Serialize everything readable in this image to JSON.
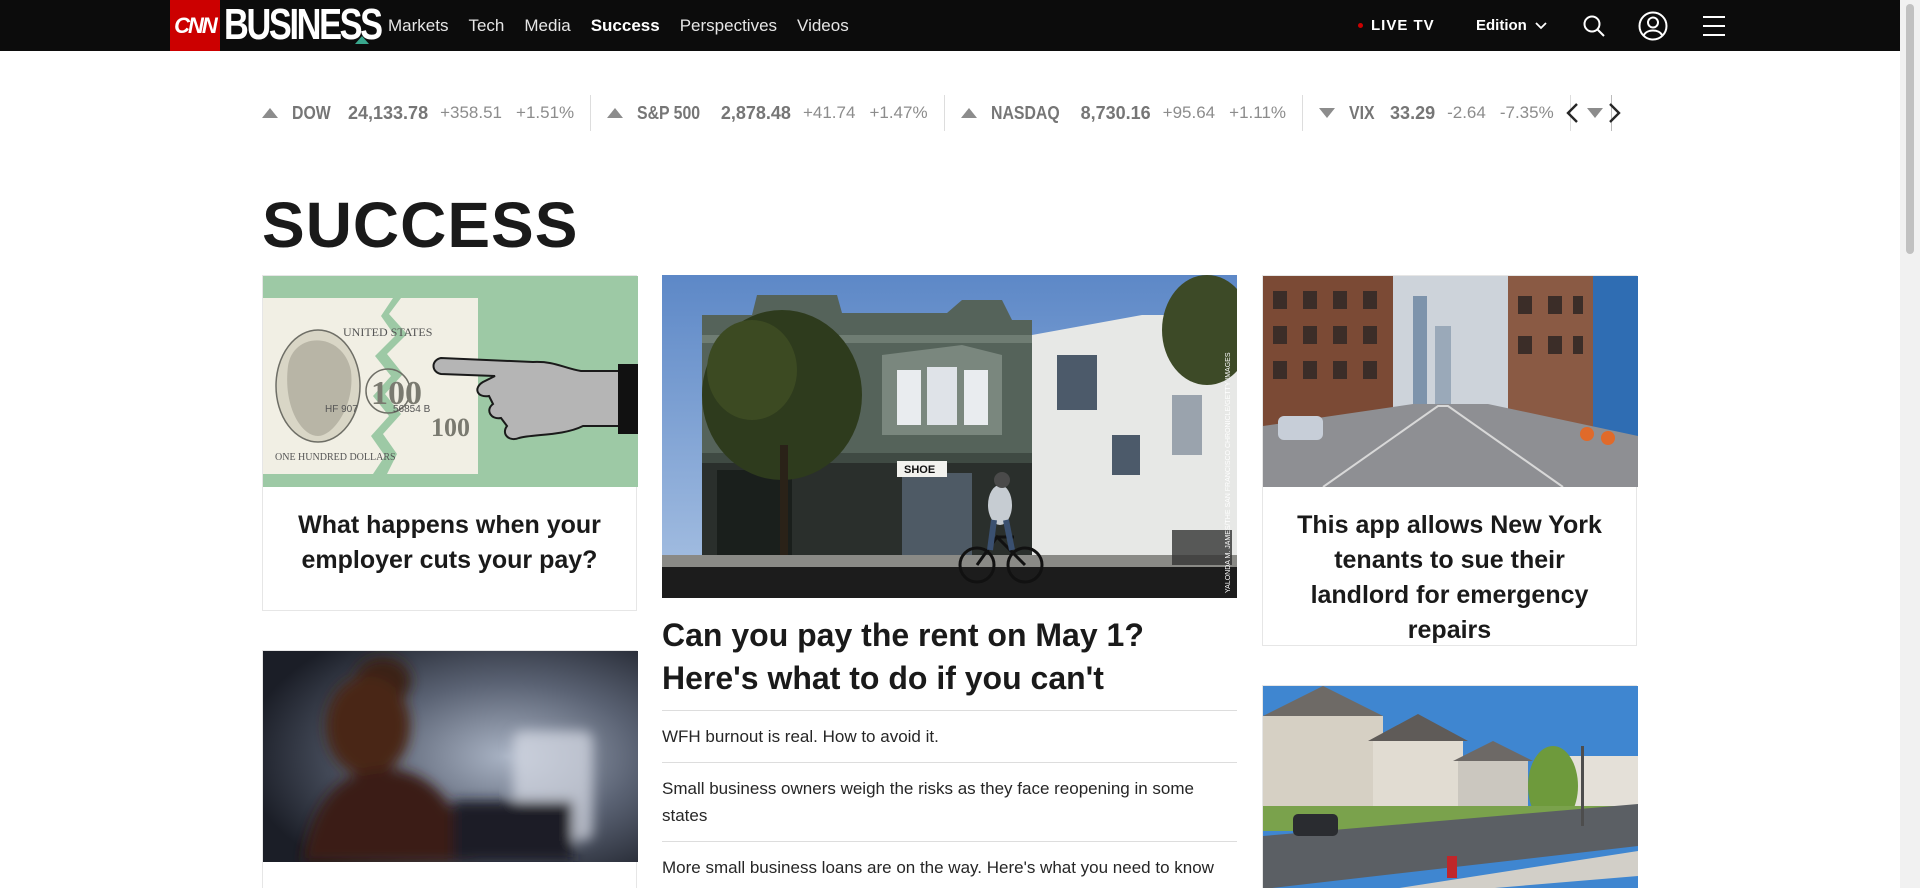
{
  "header": {
    "logo_cnn": "CNN",
    "logo_business": "BUSINESS",
    "nav": [
      {
        "label": "Markets",
        "active": false
      },
      {
        "label": "Tech",
        "active": false
      },
      {
        "label": "Media",
        "active": false
      },
      {
        "label": "Success",
        "active": true
      },
      {
        "label": "Perspectives",
        "active": false
      },
      {
        "label": "Videos",
        "active": false
      }
    ],
    "live_tv": "LIVE TV",
    "edition": "Edition"
  },
  "ticker": [
    {
      "name": "DOW",
      "value": "24,133.78",
      "change": "+358.51",
      "percent": "+1.51%",
      "direction": "up"
    },
    {
      "name": "S&P 500",
      "value": "2,878.48",
      "change": "+41.74",
      "percent": "+1.47%",
      "direction": "up"
    },
    {
      "name": "NASDAQ",
      "value": "8,730.16",
      "change": "+95.64",
      "percent": "+1.11%",
      "direction": "up"
    },
    {
      "name": "VIX",
      "value": "33.29",
      "change": "-2.64",
      "percent": "-7.35%",
      "direction": "down"
    }
  ],
  "section_title": "SUCCESS",
  "cards": {
    "pay_cut": {
      "headline": "What happens when your employer cuts your pay?"
    },
    "ny_app": {
      "headline": "This app allows New York tenants to sue their landlord for emergency repairs"
    }
  },
  "lead": {
    "headline": "Can you pay the rent on May 1? Here's what to do if you can't",
    "photo_credit": "YALONDA M. JAMES/THE SAN FRANCISCO CHRONICLE/GETTY IMAGES",
    "shop_sign": "SHOE",
    "related": [
      "WFH burnout is real. How to avoid it.",
      "Small business owners weigh the risks as they face reopening in some states",
      "More small business loans are on the way. Here's what you need to know"
    ]
  },
  "illustration": {
    "serial": "HF 907",
    "serial2": "56854 B",
    "denomination": "100",
    "text_top": "UNITED STATES",
    "text_bottom": "ONE HUNDRED DOLLARS"
  },
  "colors": {
    "brand_red": "#cc0000",
    "nav_bg": "#0c0c0c",
    "accent_green": "#3aa88e"
  }
}
